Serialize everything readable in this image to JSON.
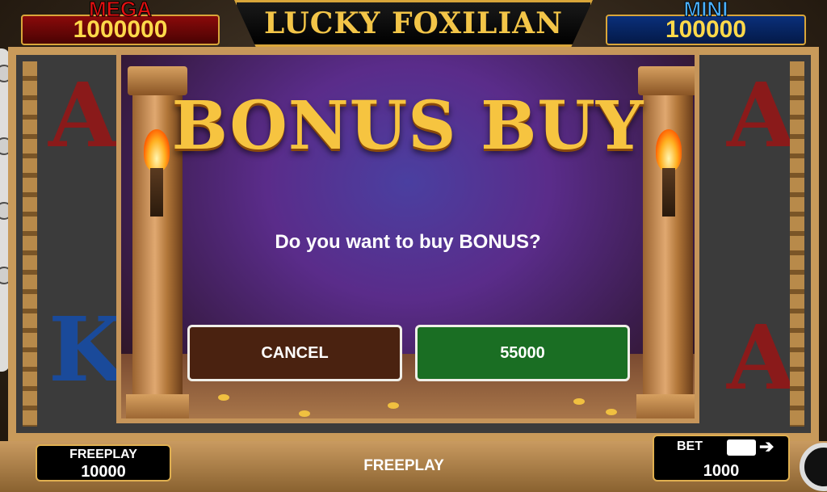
{
  "jackpots": {
    "mega": {
      "label": "MEGA",
      "value": "1000000"
    },
    "mini": {
      "label": "MINI",
      "value": "100000"
    }
  },
  "game": {
    "title": "LUCKY FOXILIAN"
  },
  "modal": {
    "title": "BONUS BUY",
    "question": "Do you want to buy BONUS?",
    "cancel_label": "CANCEL",
    "confirm_label": "55000"
  },
  "bottom": {
    "freeplay_label": "FREEPLAY",
    "freeplay_value": "10000",
    "center_label": "FREEPLAY",
    "bet_label": "BET",
    "bet_value": "1000"
  },
  "colors": {
    "mega": "#e01010",
    "mini": "#4ab0ff",
    "cancel_button": "#4a2210",
    "confirm_button": "#1a6e23",
    "gold_title": "#f6c440"
  },
  "icons": [
    "flame-icon",
    "arrow-right-icon",
    "spin-ring-icon"
  ]
}
